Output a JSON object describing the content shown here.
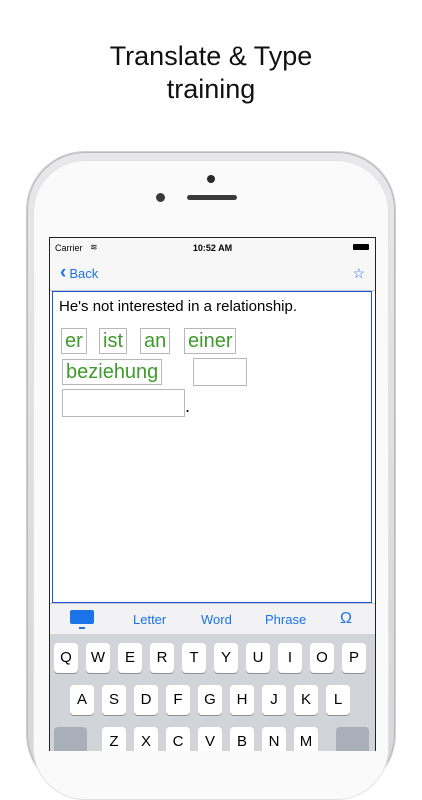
{
  "headline": {
    "line1": "Translate & Type",
    "line2": "training"
  },
  "statusbar": {
    "carrier": "Carrier",
    "wifi": "≋",
    "time": "10:52 AM"
  },
  "navbar": {
    "back_label": "Back",
    "back_chevron": "‹",
    "star": "☆"
  },
  "sentence": "He's not interested in a relationship.",
  "words": [
    "er",
    "ist",
    "an",
    "einer",
    "beziehung"
  ],
  "period": ".",
  "toolbar": {
    "letter": "Letter",
    "word": "Word",
    "phrase": "Phrase",
    "hint_icon": "Ω"
  },
  "keyboard": {
    "row1": [
      "Q",
      "W",
      "E",
      "R",
      "T",
      "Y",
      "U",
      "I",
      "O",
      "P"
    ],
    "row2": [
      "A",
      "S",
      "D",
      "F",
      "G",
      "H",
      "J",
      "K",
      "L"
    ],
    "row3": [
      "Z",
      "X",
      "C",
      "V",
      "B",
      "N",
      "M"
    ]
  }
}
